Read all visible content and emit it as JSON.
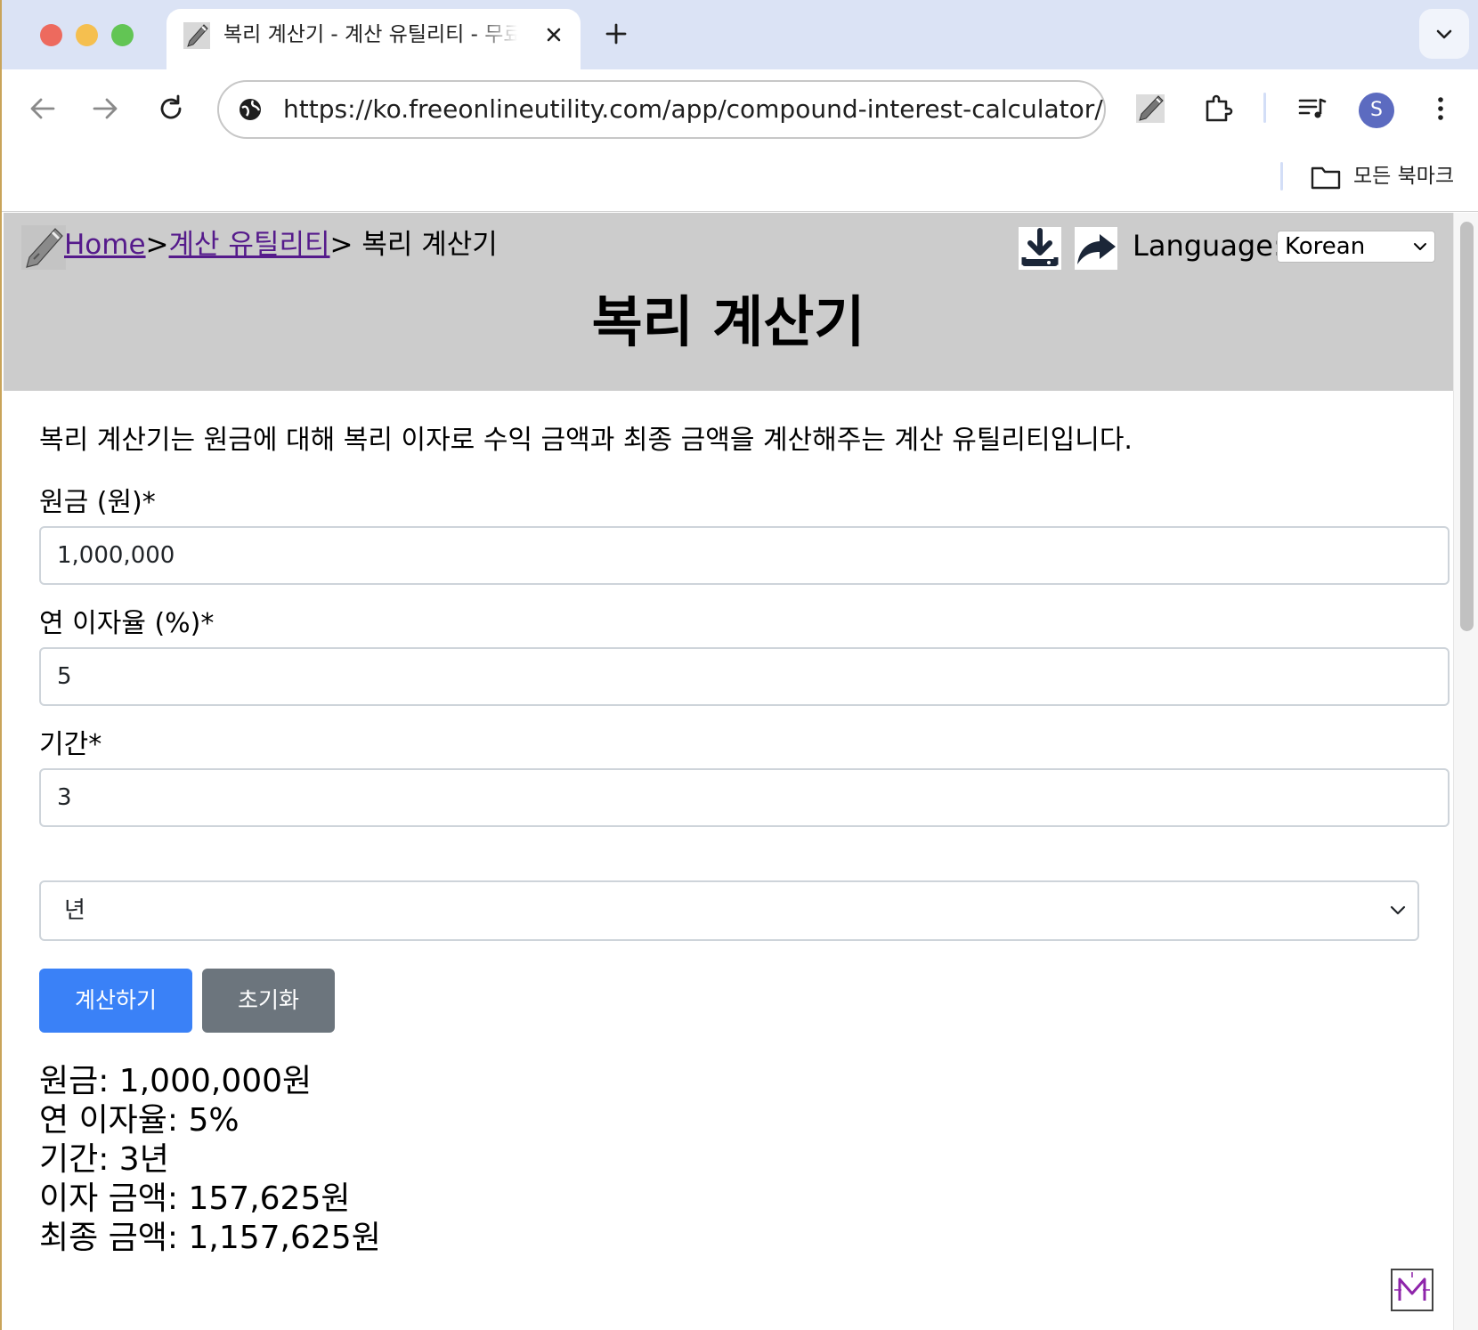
{
  "browser": {
    "tab_title": "복리 계산기 - 계산 유틸리티 - 무료",
    "url": "https://ko.freeonlineutility.com/app/compound-interest-calculator/",
    "avatar_initial": "S",
    "bookmarks_label": "모든 북마크"
  },
  "header": {
    "breadcrumb": {
      "home": "Home",
      "sep1": ">",
      "category": "계산 유틸리티",
      "sep2": ">",
      "current": " 복리 계산기"
    },
    "language_label": "Language:",
    "language_value": "Korean",
    "title": "복리 계산기"
  },
  "main": {
    "description": "복리 계산기는 원금에 대해 복리 이자로 수익 금액과 최종 금액을 계산해주는 계산 유틸리티입니다.",
    "principal_label": "원금 (원)*",
    "principal_value": "1,000,000",
    "rate_label": "연 이자율 (%)*",
    "rate_value": "5",
    "period_label": "기간*",
    "period_value": "3",
    "period_unit": "년",
    "calc_button": "계산하기",
    "reset_button": "초기화"
  },
  "results": [
    "원금: 1,000,000원",
    "연 이자율: 5%",
    "기간: 3년",
    "이자 금액: 157,625원",
    "최종 금액: 1,157,625원"
  ],
  "colors": {
    "primary_button": "#3a81f7",
    "secondary_button": "#6c757d",
    "header_bg": "#cccccc",
    "link": "#551a8b"
  }
}
